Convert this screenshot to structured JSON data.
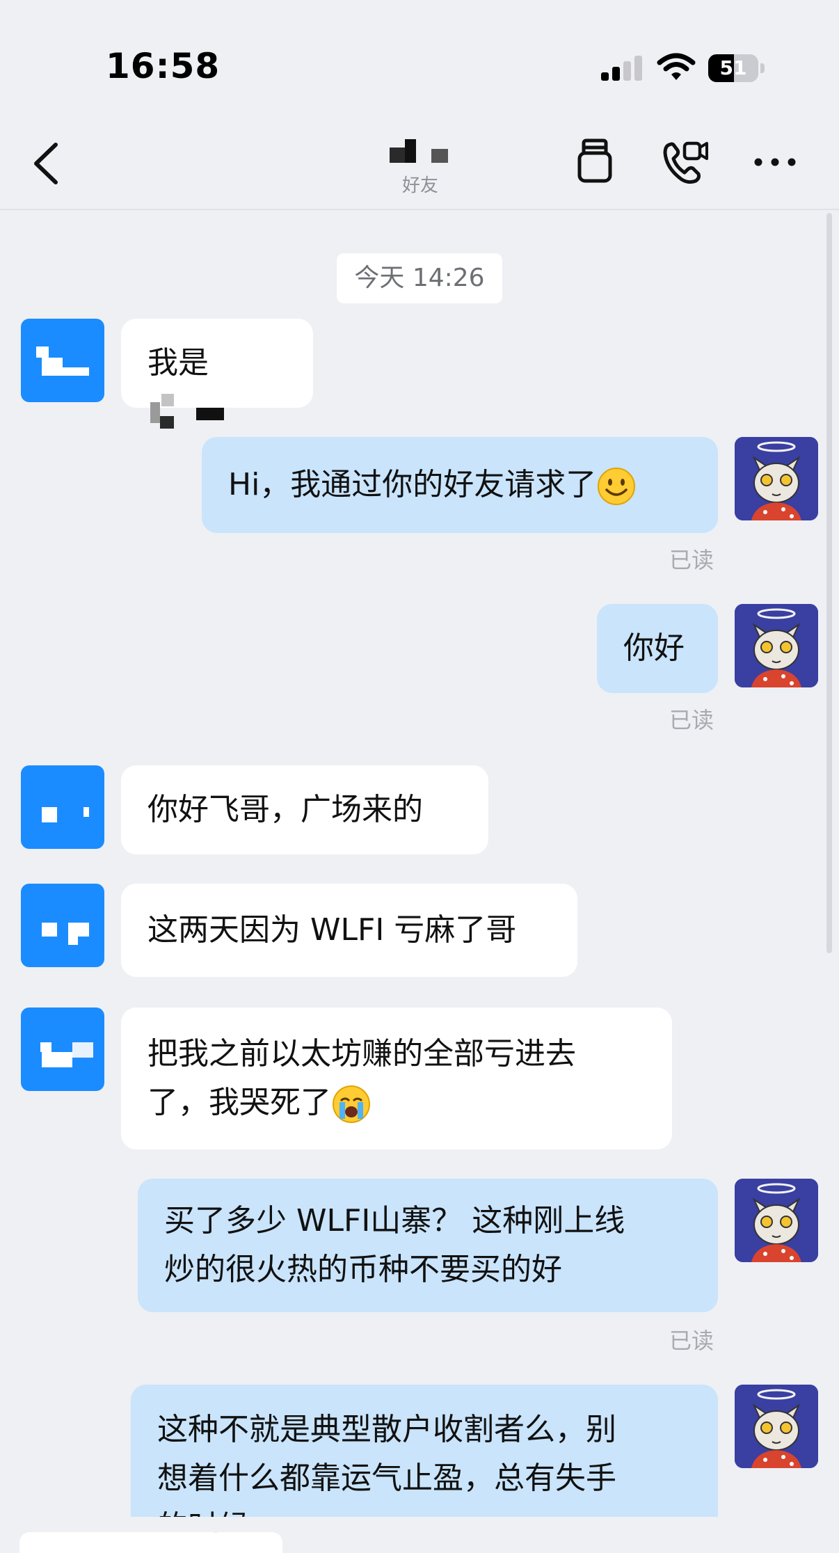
{
  "status_bar": {
    "time": "16:58",
    "battery_percent": "51",
    "battery_level": 0.51,
    "icons": [
      "signal-icon",
      "wifi-icon",
      "battery-icon"
    ]
  },
  "header": {
    "subtitle": "好友",
    "icons": [
      "back-icon",
      "shop-bag-icon",
      "video-call-icon",
      "more-icon"
    ]
  },
  "timestamp": "今天 14:26",
  "messages": [
    {
      "side": "in",
      "text": "我是"
    },
    {
      "side": "out",
      "text": "Hi，我通过你的好友请求了",
      "emoji": "smiling-face-emoji",
      "status": "已读"
    },
    {
      "side": "out",
      "text": "你好",
      "status": "已读"
    },
    {
      "side": "in",
      "text": "你好飞哥，广场来的"
    },
    {
      "side": "in",
      "text": "这两天因为 WLFI 亏麻了哥"
    },
    {
      "side": "in",
      "line1": "把我之前以太坊赚的全部亏进去",
      "line2": "了，我哭死了",
      "emoji": "loudly-crying-face-emoji"
    },
    {
      "side": "out",
      "line1": "买了多少 WLFI山寨？ 这种刚上线",
      "line2": "炒的很火热的币种不要买的好",
      "status": "已读"
    },
    {
      "side": "out",
      "line1": "这种不就是典型散户收割者么，别",
      "line2": "想着什么都靠运气止盈，总有失手",
      "line3": "的时候"
    }
  ],
  "colors": {
    "background": "#eef0f4",
    "outgoing_bubble": "#c9e4fb",
    "incoming_bubble": "#ffffff",
    "friend_avatar": "#1a8cff",
    "my_avatar": "#3a3fa2"
  }
}
